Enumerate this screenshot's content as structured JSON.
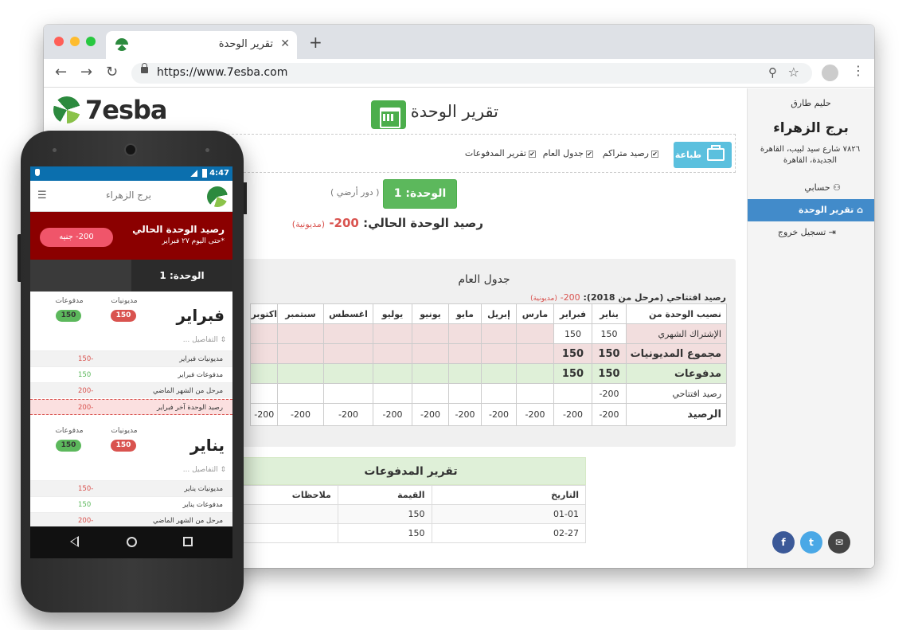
{
  "browser": {
    "tab_title": "تقرير الوحدة",
    "tab_close": "✕",
    "new_tab": "+",
    "url": "https://www.7esba.com"
  },
  "logo": {
    "text": "7esba"
  },
  "sidebar": {
    "user": "حليم طارق",
    "building": "برج الزهراء",
    "address": "٧٨٢٦ شارع سيد لبيب، القاهرة الجديدة، القاهرة",
    "items": [
      {
        "label": "حسابي",
        "icon": "user-icon"
      },
      {
        "label": "تقرير الوحدة",
        "icon": "home-icon"
      },
      {
        "label": "تسجيل خروج",
        "icon": "logout-icon"
      }
    ],
    "share": {
      "facebook": "f",
      "twitter": "t",
      "email": "✉"
    }
  },
  "page": {
    "title": "تقرير الوحدة",
    "print_label": "طباعة",
    "options": [
      {
        "label": "رصيد متراكم",
        "checked": true
      },
      {
        "label": "جدول العام",
        "checked": true
      },
      {
        "label": "تقرير المدفوعات",
        "checked": true
      }
    ],
    "unit_label": "الوحدة: 1",
    "floor": "( دور أرضي )",
    "balance_label": "رصيد الوحدة الحالي:",
    "balance_value": "200-",
    "balance_status": "(مديونية)"
  },
  "general_table": {
    "title": "جدول العام",
    "opening_label": "رصيد افتتاحي (مرحل من 2018):",
    "opening_value": "200-",
    "opening_status": "(مديونية)",
    "header_label": "نصيب الوحدة من",
    "months": [
      "يناير",
      "فبراير",
      "مارس",
      "إبريل",
      "مايو",
      "يونيو",
      "يوليو",
      "اغسطس",
      "سبتمبر",
      "اكتوبر"
    ],
    "rows": [
      {
        "label": "الإشتراك الشهري",
        "values": [
          "150",
          "150",
          "",
          "",
          "",
          "",
          "",
          "",
          "",
          ""
        ]
      },
      {
        "label": "مجموع المديونيات",
        "values": [
          "150",
          "150",
          "",
          "",
          "",
          "",
          "",
          "",
          "",
          ""
        ]
      },
      {
        "label": "مدفوعات",
        "values": [
          "150",
          "150",
          "",
          "",
          "",
          "",
          "",
          "",
          "",
          ""
        ]
      },
      {
        "label": "رصيد افتتاحي",
        "values": [
          "200-",
          "",
          "",
          "",
          "",
          "",
          "",
          "",
          "",
          ""
        ]
      },
      {
        "label": "الرصيد",
        "values": [
          "200-",
          "200-",
          "200-",
          "200-",
          "200-",
          "200-",
          "200-",
          "200-",
          "200-",
          "200-"
        ]
      }
    ]
  },
  "payments": {
    "title": "تقرير المدفوعات",
    "headers": [
      "التاريخ",
      "القيمة",
      "ملاحظات"
    ],
    "rows": [
      [
        "01-01",
        "150",
        ""
      ],
      [
        "02-27",
        "150",
        ""
      ]
    ]
  },
  "phone": {
    "time": "4:47",
    "title": "برج الزهراء",
    "balance_title": "رصيد الوحدة الحالي",
    "balance_sub": "*حتى اليوم ٢٧ فبراير",
    "balance_pill": "200- جنيه",
    "unit_label": "الوحدة: 1",
    "months": [
      {
        "name": "فبراير",
        "debts_label": "مديونيات",
        "debts": "150",
        "payments_label": "مدفوعات",
        "payments": "150",
        "details": "التفاصيل ...",
        "rows": [
          {
            "label": "مديونيات فبراير",
            "value": "-150"
          },
          {
            "label": "مدفوعات فبراير",
            "value": "150"
          },
          {
            "label": "مرحل من الشهر الماضي",
            "value": "-200"
          },
          {
            "label": "رصيد الوحدة آخر فبراير",
            "value": "-200"
          }
        ]
      },
      {
        "name": "يناير",
        "debts_label": "مديونيات",
        "debts": "150",
        "payments_label": "مدفوعات",
        "payments": "150",
        "details": "التفاصيل ...",
        "rows": [
          {
            "label": "مديونيات يناير",
            "value": "-150"
          },
          {
            "label": "مدفوعات يناير",
            "value": "150"
          },
          {
            "label": "مرحل من الشهر الماضي",
            "value": "-200"
          }
        ]
      }
    ]
  }
}
